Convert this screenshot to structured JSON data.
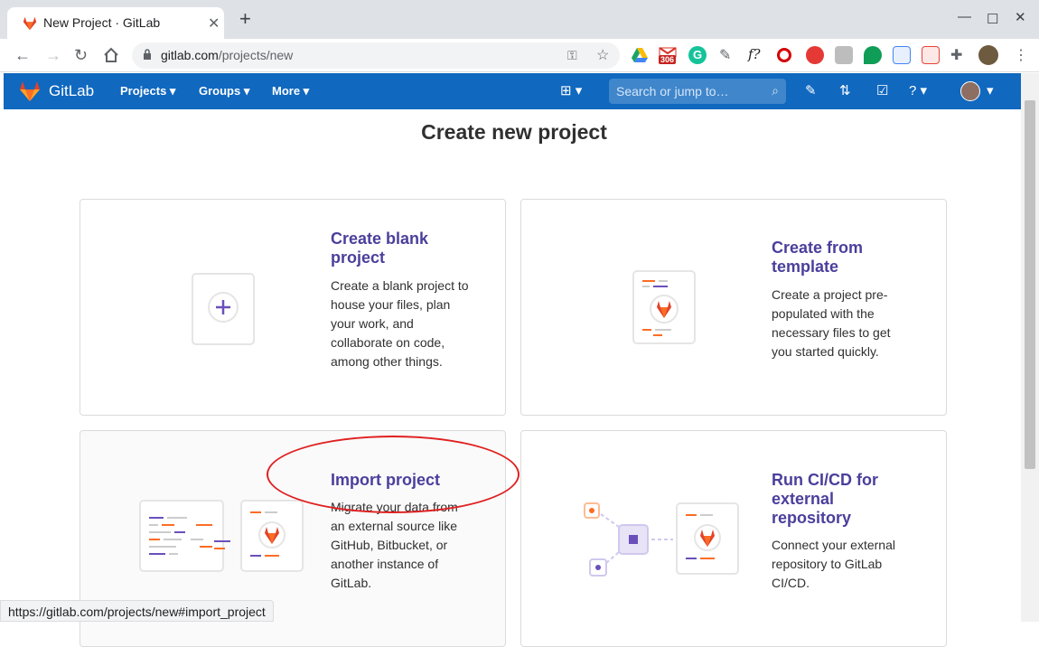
{
  "browser": {
    "tab_title": "New Project · GitLab",
    "url_host": "gitlab.com",
    "url_path": "/projects/new",
    "gmail_badge": "306"
  },
  "gitlab_nav": {
    "brand": "GitLab",
    "menus": [
      "Projects",
      "Groups",
      "More"
    ],
    "search_placeholder": "Search or jump to…"
  },
  "page": {
    "title": "Create new project",
    "cards": [
      {
        "title": "Create blank project",
        "description": "Create a blank project to house your files, plan your work, and collaborate on code, among other things."
      },
      {
        "title": "Create from template",
        "description": "Create a project pre-populated with the necessary files to get you started quickly."
      },
      {
        "title": "Import project",
        "description": "Migrate your data from an external source like GitHub, Bitbucket, or another instance of GitLab."
      },
      {
        "title": "Run CI/CD for external repository",
        "description": "Connect your external repository to GitLab CI/CD."
      }
    ]
  },
  "status_bar": "https://gitlab.com/projects/new#import_project",
  "colors": {
    "navbar": "#1068bf",
    "card_title": "#4a3f9c",
    "gitlab_orange": "#fc6d26",
    "annotation": "#e02020"
  }
}
